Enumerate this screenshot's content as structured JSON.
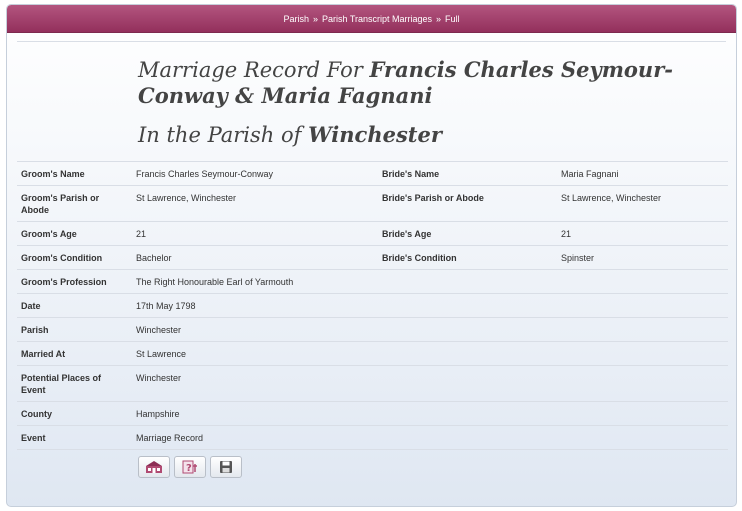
{
  "breadcrumb": {
    "items": [
      "Parish",
      "Parish Transcript Marriages",
      "Full"
    ],
    "separator": "»"
  },
  "title": {
    "prefix": "Marriage Record For ",
    "names": "Francis Charles Seymour-Conway & Maria Fagnani"
  },
  "subtitle": {
    "prefix": "In the Parish of ",
    "place": "Winchester"
  },
  "record": {
    "groom_name_label": "Groom's Name",
    "groom_name": "Francis Charles Seymour-Conway",
    "bride_name_label": "Bride's Name",
    "bride_name": "Maria Fagnani",
    "groom_parish_label": "Groom's Parish or Abode",
    "groom_parish": "St Lawrence, Winchester",
    "bride_parish_label": "Bride's Parish or Abode",
    "bride_parish": "St Lawrence, Winchester",
    "groom_age_label": "Groom's Age",
    "groom_age": "21",
    "bride_age_label": "Bride's Age",
    "bride_age": "21",
    "groom_condition_label": "Groom's Condition",
    "groom_condition": "Bachelor",
    "bride_condition_label": "Bride's Condition",
    "bride_condition": "Spinster",
    "groom_profession_label": "Groom's Profession",
    "groom_profession": "The Right Honourable Earl of Yarmouth",
    "date_label": "Date",
    "date": "17th May 1798",
    "parish_label": "Parish",
    "parish": "Winchester",
    "married_at_label": "Married At",
    "married_at": "St Lawrence",
    "places_label": "Potential Places of Event",
    "places": "Winchester",
    "county_label": "County",
    "county": "Hampshire",
    "event_label": "Event",
    "event": "Marriage Record"
  },
  "actions": {
    "icons": [
      "family-tree-icon",
      "query-icon",
      "save-icon"
    ]
  },
  "colors": {
    "header_bar": "#a3416c",
    "panel_gradient_bottom": "#dfe7f2"
  }
}
